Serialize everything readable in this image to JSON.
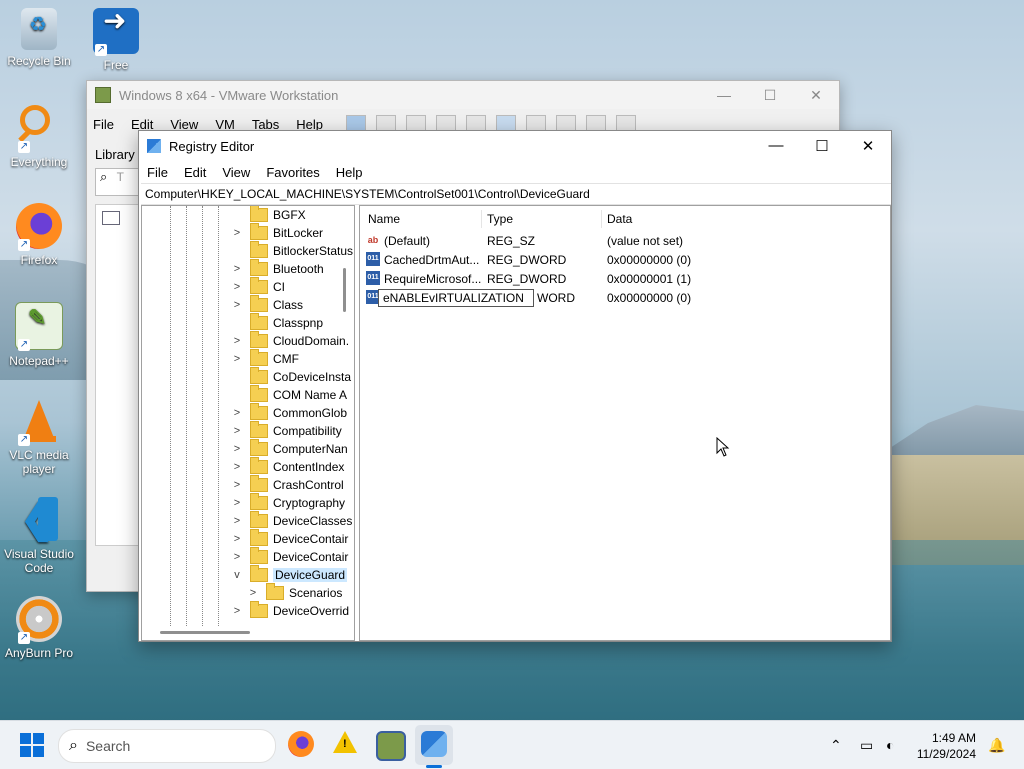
{
  "desktop": {
    "icons": [
      {
        "label": "Recycle Bin",
        "icon": "recycle-bin-icon"
      },
      {
        "label": "Free Download",
        "icon": "download-icon"
      },
      {
        "label": "Everything",
        "icon": "search-everything-icon"
      },
      {
        "label": "Firefox",
        "icon": "firefox-icon"
      },
      {
        "label": "Notepad++",
        "icon": "notepadpp-icon"
      },
      {
        "label": "VLC media player",
        "icon": "vlc-icon"
      },
      {
        "label": "Visual Studio Code",
        "icon": "vscode-icon"
      },
      {
        "label": "AnyBurn Pro",
        "icon": "anyburn-icon"
      }
    ]
  },
  "vmware": {
    "title": "Windows 8 x64 - VMware Workstation",
    "menu": [
      "File",
      "Edit",
      "View",
      "VM",
      "Tabs",
      "Help"
    ],
    "library_label": "Library",
    "search_hint": "T"
  },
  "regedit": {
    "title": "Registry Editor",
    "menu": [
      "File",
      "Edit",
      "View",
      "Favorites",
      "Help"
    ],
    "address": "Computer\\HKEY_LOCAL_MACHINE\\SYSTEM\\ControlSet001\\Control\\DeviceGuard",
    "tree": [
      {
        "label": "BGFX",
        "expander": ""
      },
      {
        "label": "BitLocker",
        "expander": ">"
      },
      {
        "label": "BitlockerStatus",
        "expander": ""
      },
      {
        "label": "Bluetooth",
        "expander": ">"
      },
      {
        "label": "CI",
        "expander": ">"
      },
      {
        "label": "Class",
        "expander": ">"
      },
      {
        "label": "Classpnp",
        "expander": ""
      },
      {
        "label": "CloudDomain.",
        "expander": ">"
      },
      {
        "label": "CMF",
        "expander": ">"
      },
      {
        "label": "CoDeviceInsta",
        "expander": ""
      },
      {
        "label": "COM Name A",
        "expander": ""
      },
      {
        "label": "CommonGlob",
        "expander": ">"
      },
      {
        "label": "Compatibility",
        "expander": ">"
      },
      {
        "label": "ComputerNan",
        "expander": ">"
      },
      {
        "label": "ContentIndex",
        "expander": ">"
      },
      {
        "label": "CrashControl",
        "expander": ">"
      },
      {
        "label": "Cryptography",
        "expander": ">"
      },
      {
        "label": "DeviceClasses",
        "expander": ">"
      },
      {
        "label": "DeviceContair",
        "expander": ">"
      },
      {
        "label": "DeviceContair",
        "expander": ">"
      },
      {
        "label": "DeviceGuard",
        "expander": "v",
        "selected": true
      },
      {
        "label": "Scenarios",
        "expander": ">",
        "child": true
      },
      {
        "label": "DeviceOverrid",
        "expander": ">"
      }
    ],
    "columns": {
      "name": "Name",
      "type": "Type",
      "data": "Data"
    },
    "values": [
      {
        "name": "(Default)",
        "type": "REG_SZ",
        "data": "(value not set)",
        "kind": "sz"
      },
      {
        "name": "CachedDrtmAut...",
        "type": "REG_DWORD",
        "data": "0x00000000 (0)",
        "kind": "bin"
      },
      {
        "name": "RequireMicrosof...",
        "type": "REG_DWORD",
        "data": "0x00000001 (1)",
        "kind": "bin"
      },
      {
        "name": "",
        "type": "WORD",
        "data": "0x00000000 (0)",
        "kind": "bin"
      }
    ],
    "rename_value": "eNABLEvIRTUALIZATION"
  },
  "taskbar": {
    "search_placeholder": "Search",
    "time": "1:49 AM",
    "date": "11/29/2024"
  }
}
